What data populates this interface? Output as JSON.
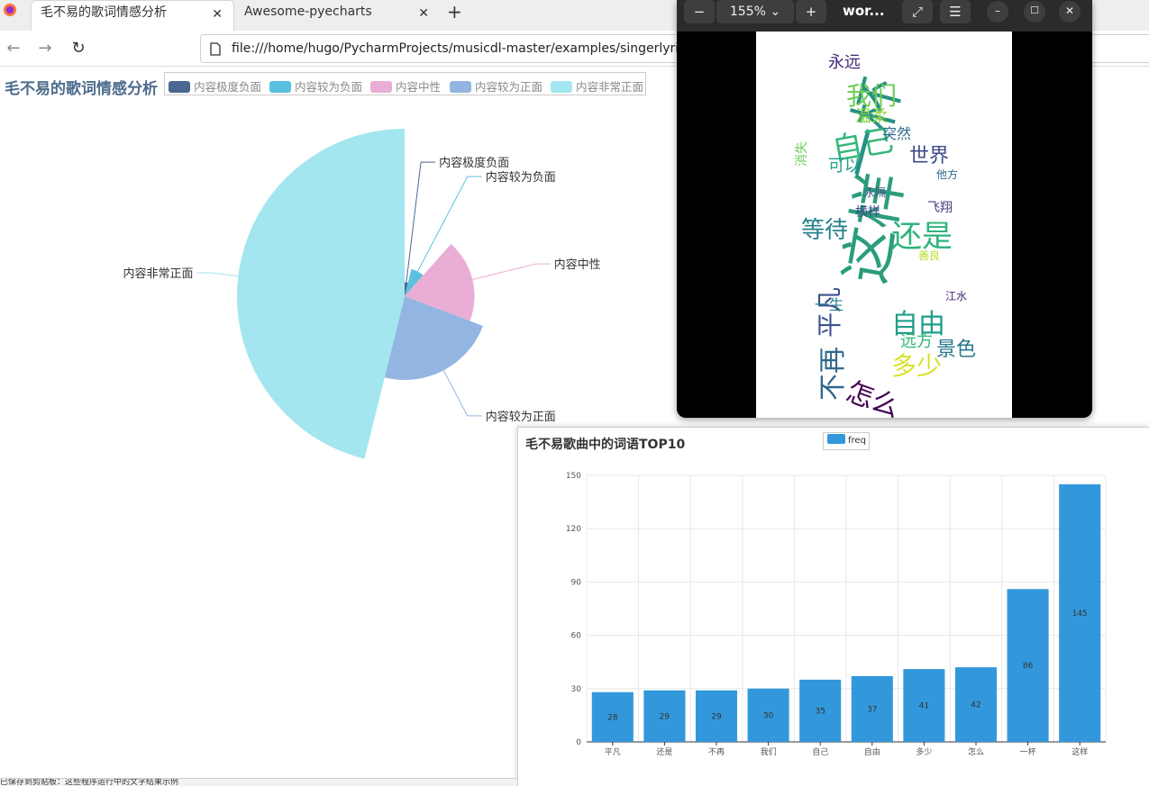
{
  "browser": {
    "tabs": [
      {
        "label": "毛不易的歌词情感分析",
        "active": true
      },
      {
        "label": "Awesome-pyecharts",
        "active": false
      }
    ],
    "new_tab": "+",
    "close_glyph": "✕",
    "url": "file:///home/hugo/PycharmProjects/musicdl-master/examples/singerlyrics"
  },
  "pie_chart": {
    "chart_data": {
      "type": "pie",
      "rose_type": "radius",
      "title": "毛不易的歌词情感分析",
      "legend_position": "top",
      "categories": [
        "内容极度负面",
        "内容较为负面",
        "内容中性",
        "内容较为正面",
        "内容非常正面"
      ],
      "colors": [
        "#4a6791",
        "#5bc0e0",
        "#eaaed6",
        "#93b5e1",
        "#a4e6ef"
      ],
      "values": [
        2,
        4,
        10,
        12,
        24
      ]
    }
  },
  "viewer": {
    "zoom": "155%",
    "title": "wor...",
    "icons": [
      "zoom-out-icon",
      "zoom-in-icon",
      "fullscreen-icon",
      "menu-icon",
      "minimize-icon",
      "maximize-icon",
      "close-icon"
    ],
    "wordcloud_words": [
      {
        "text": "这样",
        "color": "#2a9d7c"
      },
      {
        "text": "一杯",
        "color": "#279085"
      },
      {
        "text": "还是",
        "color": "#2fb47c"
      },
      {
        "text": "自由",
        "color": "#1f9d8a"
      },
      {
        "text": "多少",
        "color": "#d6e22b"
      },
      {
        "text": "怎么",
        "color": "#440154"
      },
      {
        "text": "不再",
        "color": "#31688e"
      },
      {
        "text": "平凡",
        "color": "#3b528b"
      },
      {
        "text": "自己",
        "color": "#35b779"
      },
      {
        "text": "我们",
        "color": "#6ece58"
      },
      {
        "text": "世界",
        "color": "#3e4a89"
      },
      {
        "text": "等待",
        "color": "#26828e"
      },
      {
        "text": "永远",
        "color": "#482878"
      },
      {
        "text": "温柔",
        "color": "#90d743"
      },
      {
        "text": "突然",
        "color": "#31688e"
      },
      {
        "text": "可以",
        "color": "#1f9e89"
      },
      {
        "text": "横样",
        "color": "#3e4a89"
      },
      {
        "text": "飞翔",
        "color": "#443983"
      },
      {
        "text": "一生",
        "color": "#26828e"
      },
      {
        "text": "远方",
        "color": "#35b779"
      },
      {
        "text": "景色",
        "color": "#2a788e"
      },
      {
        "text": "江水",
        "color": "#482878"
      },
      {
        "text": "消失",
        "color": "#6ece58"
      },
      {
        "text": "永隔",
        "color": "#3b528b"
      },
      {
        "text": "他方",
        "color": "#31688e"
      },
      {
        "text": "善良",
        "color": "#b5de2b"
      }
    ]
  },
  "bar_chart": {
    "chart_data": {
      "type": "bar",
      "title": "毛不易歌曲中的词语TOP10",
      "legend": [
        "freq"
      ],
      "color": "#3398db",
      "categories": [
        "平凡",
        "还是",
        "不再",
        "我们",
        "自己",
        "自由",
        "多少",
        "怎么",
        "一杯",
        "这样"
      ],
      "series": [
        {
          "name": "freq",
          "values": [
            28,
            29,
            29,
            30,
            35,
            37,
            41,
            42,
            86,
            145
          ]
        }
      ],
      "ylim": [
        0,
        150
      ],
      "yticks": [
        "0",
        "30",
        "60",
        "90",
        "120",
        "150"
      ],
      "grid": true
    }
  },
  "status": {
    "text": "已保存到剪贴板：这些程序运行中的文字结果示例"
  }
}
